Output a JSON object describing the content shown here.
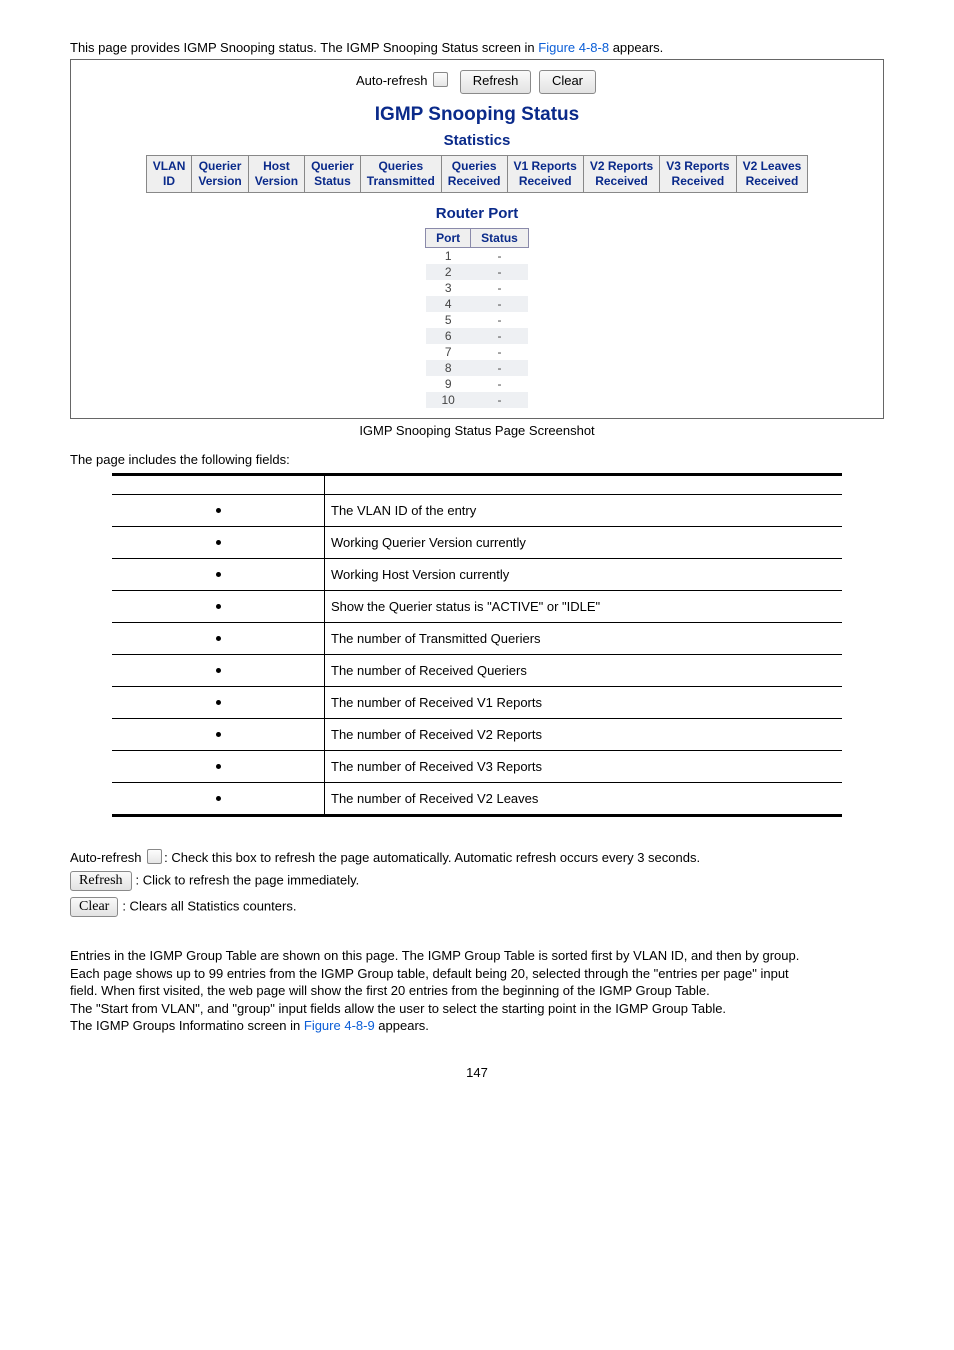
{
  "intro": {
    "prefix": "This page provides IGMP Snooping status. The IGMP Snooping Status screen in ",
    "figure_ref": "Figure 4-8-8",
    "suffix": " appears."
  },
  "panel": {
    "auto_refresh_label": "Auto-refresh",
    "refresh_label": "Refresh",
    "clear_label": "Clear",
    "title": "IGMP Snooping Status",
    "subtitle_stats": "Statistics",
    "subtitle_router": "Router Port",
    "stats_headers": {
      "h0a": "VLAN",
      "h0b": "ID",
      "h1a": "Querier",
      "h1b": "Version",
      "h2a": "Host",
      "h2b": "Version",
      "h3a": "Querier",
      "h3b": "Status",
      "h4a": "Queries",
      "h4b": "Transmitted",
      "h5a": "Queries",
      "h5b": "Received",
      "h6a": "V1 Reports",
      "h6b": "Received",
      "h7a": "V2 Reports",
      "h7b": "Received",
      "h8a": "V3 Reports",
      "h8b": "Received",
      "h9a": "V2 Leaves",
      "h9b": "Received"
    },
    "router_headers": {
      "port": "Port",
      "status": "Status"
    },
    "router_rows": [
      {
        "port": "1",
        "status": "-"
      },
      {
        "port": "2",
        "status": "-"
      },
      {
        "port": "3",
        "status": "-"
      },
      {
        "port": "4",
        "status": "-"
      },
      {
        "port": "5",
        "status": "-"
      },
      {
        "port": "6",
        "status": "-"
      },
      {
        "port": "7",
        "status": "-"
      },
      {
        "port": "8",
        "status": "-"
      },
      {
        "port": "9",
        "status": "-"
      },
      {
        "port": "10",
        "status": "-"
      }
    ]
  },
  "caption": "IGMP Snooping Status Page Screenshot",
  "fields_intro": "The page includes the following fields:",
  "fields": [
    "The VLAN ID of the entry",
    "Working Querier Version currently",
    "Working Host Version currently",
    "Show the Querier status is \"ACTIVE\" or \"IDLE\"",
    "The number of Transmitted Queriers",
    "The number of Received Queriers",
    "The number of Received V1 Reports",
    "The number of Received V2 Reports",
    "The number of Received V3 Reports",
    "The number of Received V2 Leaves"
  ],
  "notes": {
    "auto_refresh_prefix": "Auto-refresh ",
    "auto_refresh_suffix": ": Check this box to refresh the page automatically. Automatic refresh occurs every 3 seconds.",
    "refresh_btn_label": "Refresh",
    "refresh_suffix": ": Click to refresh the page immediately.",
    "clear_btn_label": "Clear",
    "clear_suffix": ": Clears all Statistics counters."
  },
  "groups": {
    "l1": "Entries in the IGMP Group Table are shown on this page. The IGMP Group Table is sorted first by VLAN ID, and then by group.",
    "l2": "Each page shows up to 99 entries from the IGMP Group table, default being 20, selected through the \"entries per page\" input",
    "l3": "field. When first visited, the web page will show the first 20 entries from the beginning of the IGMP Group Table.",
    "l4": "The \"Start from VLAN\", and \"group\" input fields allow the user to select the starting point in the IGMP Group Table.",
    "l5_prefix": "The IGMP Groups Informatino screen in ",
    "l5_link": "Figure 4-8-9",
    "l5_suffix": " appears."
  },
  "page_number": "147"
}
